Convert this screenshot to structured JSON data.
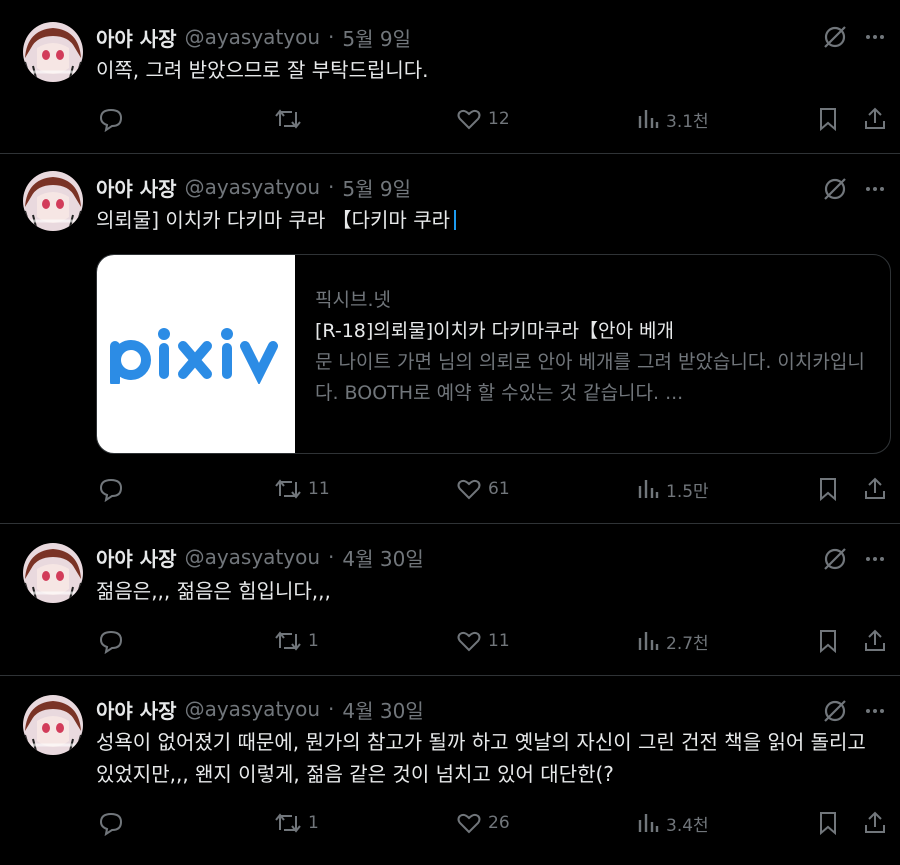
{
  "colors": {
    "background": "#000000",
    "text": "#e7e9ea",
    "muted": "#71767b",
    "divider": "#2f3336",
    "accent": "#1d9bf0"
  },
  "tweets": [
    {
      "name": "아야 사장",
      "handle": "@ayasyatyou",
      "separator": "·",
      "date": "5월 9일",
      "text": "이쪽, 그려 받았으므로 잘 부탁드립니다.",
      "replies": "",
      "retweets": "",
      "likes": "12",
      "views": "3.1천",
      "icons": [
        "grok-icon",
        "more-icon",
        "reply-icon",
        "retweet-icon",
        "like-icon",
        "views-icon",
        "bookmark-icon",
        "share-icon"
      ]
    },
    {
      "name": "아야 사장",
      "handle": "@ayasyatyou",
      "separator": "·",
      "date": "5월 9일",
      "text": "의뢰물] 이치카 다키마 쿠라 【다키마 쿠라",
      "replies": "",
      "retweets": "11",
      "likes": "61",
      "views": "1.5만",
      "card": {
        "logo": "pixiv",
        "domain": "픽시브.넷",
        "title": "[R-18]의뢰물]이치카 다키마쿠라【안아 베개",
        "description": "문 나이트 가면 님의 의뢰로 안아 베개를 그려 받았습니다. 이치카입니다. BOOTH로 예약 할 수있는 것 같습니다. ..."
      }
    },
    {
      "name": "아야 사장",
      "handle": "@ayasyatyou",
      "separator": "·",
      "date": "4월 30일",
      "text": "젊음은,,, 젊음은 힘입니다,,,",
      "replies": "",
      "retweets": "1",
      "likes": "11",
      "views": "2.7천"
    },
    {
      "name": "아야 사장",
      "handle": "@ayasyatyou",
      "separator": "·",
      "date": "4월 30일",
      "text": "성욕이 없어졌기 때문에, 뭔가의 참고가 될까 하고 옛날의 자신이 그린 건전 책을 읽어 돌리고 있었지만,,, 왠지 이렇게, 젊음 같은 것이 넘치고 있어 대단한(?",
      "replies": "",
      "retweets": "1",
      "likes": "26",
      "views": "3.4천"
    }
  ]
}
